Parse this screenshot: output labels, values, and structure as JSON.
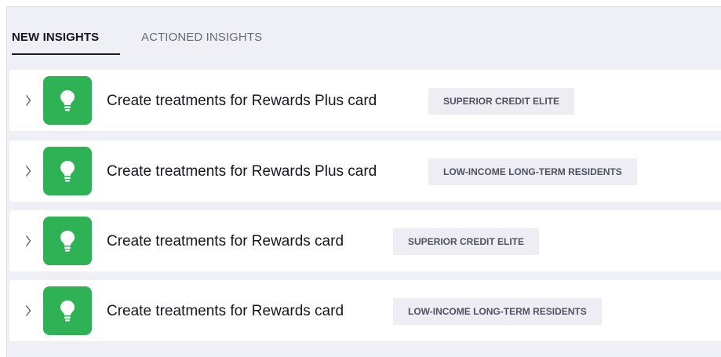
{
  "tabs": {
    "new_insights": "NEW INSIGHTS",
    "actioned_insights": "ACTIONED INSIGHTS"
  },
  "insights": [
    {
      "title": "Create treatments for Rewards Plus card",
      "segment": "SUPERIOR CREDIT ELITE"
    },
    {
      "title": "Create treatments for Rewards Plus card",
      "segment": "LOW-INCOME LONG-TERM RESIDENTS"
    },
    {
      "title": "Create treatments for Rewards card",
      "segment": "SUPERIOR CREDIT ELITE"
    },
    {
      "title": "Create treatments for Rewards card",
      "segment": "LOW-INCOME LONG-TERM RESIDENTS"
    }
  ],
  "icons": {
    "expand": "chevron-right-icon",
    "insight": "lightbulb-icon"
  },
  "colors": {
    "insight_tile": "#2fb155",
    "panel_background": "#eff0f6",
    "badge_background": "#ededf3",
    "active_tab_underline": "#1a1b24"
  }
}
